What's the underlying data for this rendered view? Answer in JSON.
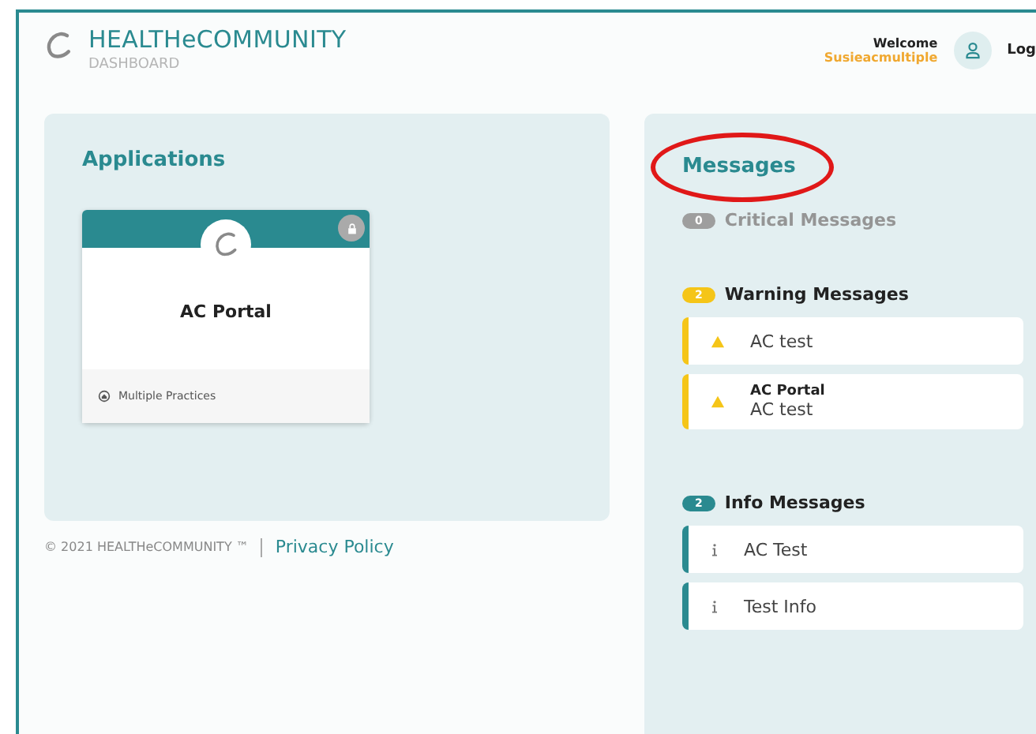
{
  "header": {
    "brand": "HEALTHeCOMMUNITY",
    "subtitle": "DASHBOARD",
    "welcome": "Welcome",
    "username": "Susieacmultiple",
    "logout": "Log"
  },
  "applications": {
    "title": "Applications",
    "cards": [
      {
        "name": "AC Portal",
        "footer": "Multiple Practices"
      }
    ]
  },
  "footer": {
    "copyright": "© 2021 HEALTHeCOMMUNITY ™",
    "link": "Privacy Policy"
  },
  "messages": {
    "title": "Messages",
    "circled": true,
    "groups": [
      {
        "kind": "critical",
        "count": "0",
        "label": "Critical Messages"
      },
      {
        "kind": "warning",
        "count": "2",
        "label": "Warning Messages",
        "items": [
          {
            "text": "AC test"
          },
          {
            "title": "AC Portal",
            "text": "AC test"
          }
        ]
      },
      {
        "kind": "info",
        "count": "2",
        "label": "Info Messages",
        "items": [
          {
            "text": "AC Test"
          },
          {
            "text": "Test Info"
          }
        ]
      }
    ]
  }
}
